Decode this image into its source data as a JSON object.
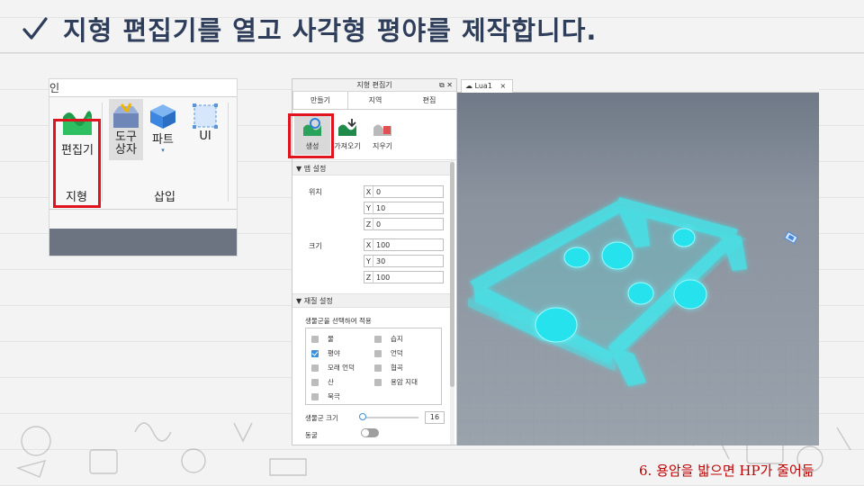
{
  "slide": {
    "title": "지형 편집기를 열고 사각형 평야를 제작합니다.",
    "caption": "6. 용암을 밟으면 HP가 줄어듦",
    "colors": {
      "title": "#2e3d5a",
      "highlight": "#e0141e",
      "caption": "#c00000"
    }
  },
  "ribbon": {
    "top_fragment": "인",
    "buttons": [
      {
        "label": "편집기",
        "icon": "terrain-editor-icon"
      },
      {
        "label": "도구\n상자",
        "icon": "toolbox-icon"
      },
      {
        "label": "파트",
        "icon": "part-cube-icon"
      },
      {
        "label": "UI",
        "icon": "ui-frame-icon"
      }
    ],
    "groups": [
      "지형",
      "삽입"
    ]
  },
  "panel": {
    "title": "지형 편집기",
    "tabs": [
      "만들기",
      "지역",
      "편집"
    ],
    "tools": [
      {
        "label": "생성",
        "icon": "generate-icon"
      },
      {
        "label": "가져오기",
        "icon": "import-icon"
      },
      {
        "label": "지우기",
        "icon": "clear-icon"
      }
    ],
    "map_section": "맵 설정",
    "position_label": "위치",
    "position": [
      {
        "axis": "X",
        "value": "0"
      },
      {
        "axis": "Y",
        "value": "10"
      },
      {
        "axis": "Z",
        "value": "0"
      }
    ],
    "size_label": "크기",
    "size": [
      {
        "axis": "X",
        "value": "100"
      },
      {
        "axis": "Y",
        "value": "30"
      },
      {
        "axis": "Z",
        "value": "100"
      }
    ],
    "material_section": "재질 설정",
    "biome_label": "생물군을 선택하여 적용",
    "materials": [
      {
        "name": "물",
        "checked": false
      },
      {
        "name": "습지",
        "checked": false
      },
      {
        "name": "평야",
        "checked": true
      },
      {
        "name": "언덕",
        "checked": false
      },
      {
        "name": "모래 언덕",
        "checked": false
      },
      {
        "name": "협곡",
        "checked": false
      },
      {
        "name": "산",
        "checked": false
      },
      {
        "name": "용암 지대",
        "checked": false
      },
      {
        "name": "북극",
        "checked": false
      }
    ],
    "biome_size_label": "생물군 크기",
    "biome_size_value": "16",
    "biome_size_slider": 0.0,
    "cave_label": "동굴",
    "cave_enabled": false
  },
  "viewport": {
    "tab_label": "Lua1",
    "close_glyph": "×",
    "colors": {
      "sky": "#7b8592",
      "ground": "#8f98a4",
      "glow": "#3fe9ef"
    }
  }
}
